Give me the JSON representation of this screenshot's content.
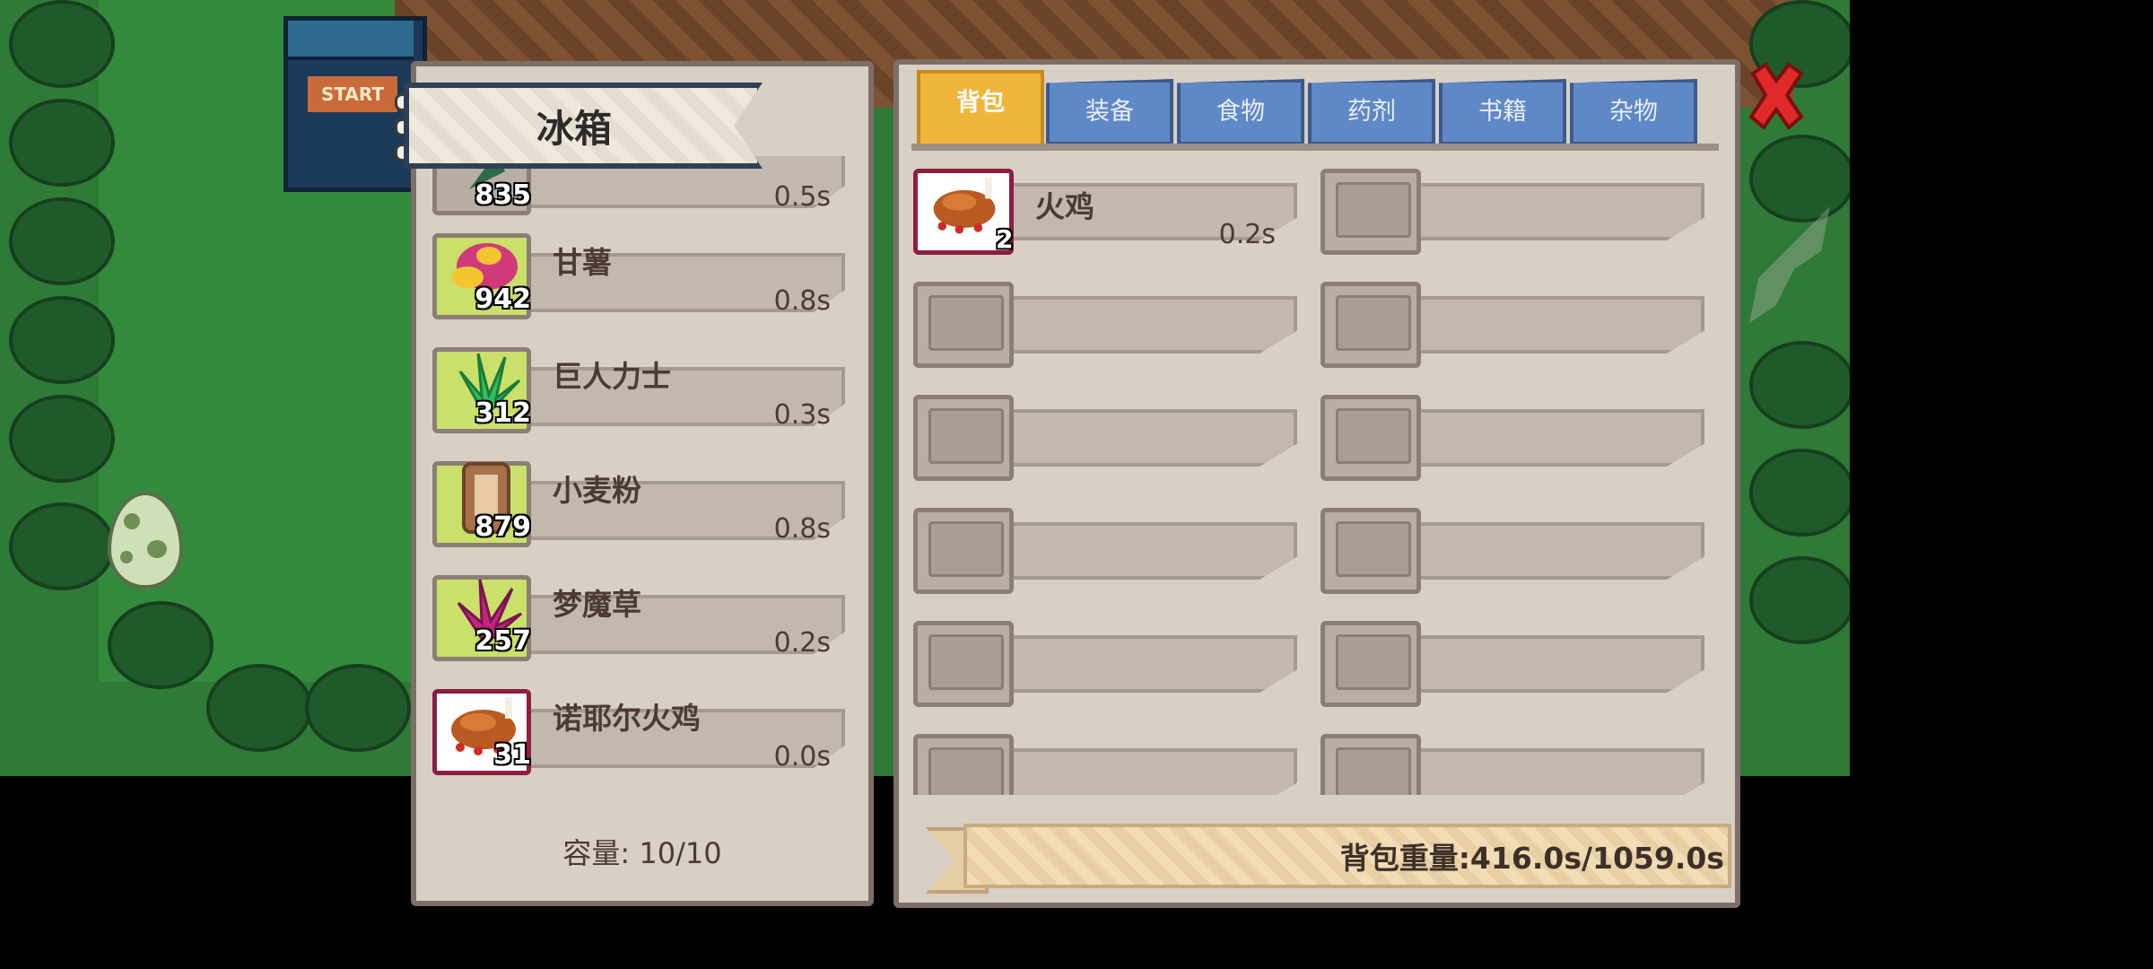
{
  "fridge": {
    "title": "冰箱",
    "items": [
      {
        "name": "",
        "count": "835",
        "weight": "0.5s",
        "icon": "leaf-herb-icon"
      },
      {
        "name": "甘薯",
        "count": "942",
        "weight": "0.8s",
        "icon": "sweet-potato-icon"
      },
      {
        "name": "巨人力士",
        "count": "312",
        "weight": "0.3s",
        "icon": "green-plant-icon"
      },
      {
        "name": "小麦粉",
        "count": "879",
        "weight": "0.8s",
        "icon": "flour-sack-icon"
      },
      {
        "name": "梦魔草",
        "count": "257",
        "weight": "0.2s",
        "icon": "purple-herb-icon"
      },
      {
        "name": "诺耶尔火鸡",
        "count": "31",
        "weight": "0.0s",
        "icon": "roast-turkey-icon"
      }
    ],
    "capacity": "容量: 10/10"
  },
  "bag": {
    "tabs": [
      "背包",
      "装备",
      "食物",
      "药剂",
      "书籍",
      "杂物"
    ],
    "active_tab": "背包",
    "slots": [
      {
        "name": "火鸡",
        "count": "2",
        "weight": "0.2s",
        "icon": "roast-turkey-icon"
      }
    ],
    "weight_text": "背包重量:416.0s/1059.0s"
  },
  "background": {
    "start_sign": "START"
  },
  "colors": {
    "active_tab": "#f0b63c",
    "inactive_tab": "#5f88c6",
    "panel": "#d8cfc5",
    "close": "#e02a2a"
  }
}
